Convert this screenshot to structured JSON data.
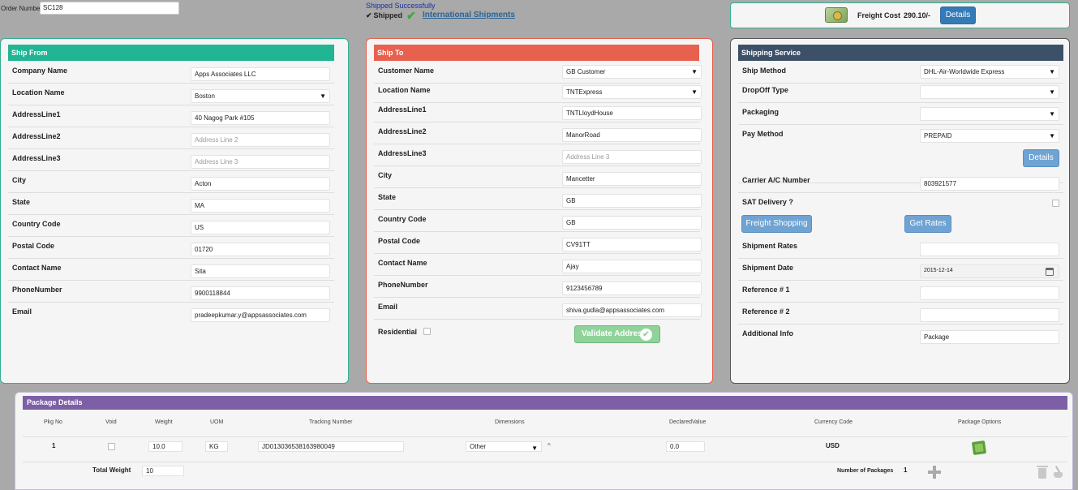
{
  "order": {
    "label": "Order Number",
    "value": "SC128"
  },
  "status": {
    "message": "Shipped Successfully",
    "checkmark": "✔",
    "state": "Shipped",
    "intl_link": "International Shipments"
  },
  "freight": {
    "label": "Freight Cost",
    "value": "290.10/-",
    "details_label": "Details"
  },
  "ship_from": {
    "title": "Ship From",
    "company_label": "Company Name",
    "company_value": "Apps Associates LLC",
    "location_label": "Location Name",
    "location_value": "Boston",
    "addr1_label": "AddressLine1",
    "addr1_value": "40 Nagog Park #105",
    "addr2_label": "AddressLine2",
    "addr2_placeholder": "Address Line 2",
    "addr3_label": "AddressLine3",
    "addr3_placeholder": "Address Line 3",
    "city_label": "City",
    "city_value": "Acton",
    "state_label": "State",
    "state_value": "MA",
    "country_label": "Country Code",
    "country_value": "US",
    "postal_label": "Postal Code",
    "postal_value": "01720",
    "contact_label": "Contact Name",
    "contact_value": "Sita",
    "phone_label": "PhoneNumber",
    "phone_value": "9900118844",
    "email_label": "Email",
    "email_value": "pradeepkumar.y@appsassociates.com"
  },
  "ship_to": {
    "title": "Ship To",
    "customer_label": "Customer Name",
    "customer_value": "GB Customer",
    "location_label": "Location Name",
    "location_value": "TNTExpress",
    "addr1_label": "AddressLine1",
    "addr1_value": "TNTLloydHouse",
    "addr2_label": "AddressLine2",
    "addr2_value": "ManorRoad",
    "addr3_label": "AddressLine3",
    "addr3_placeholder": "Address Line 3",
    "city_label": "City",
    "city_value": "Mancetter",
    "state_label": "State",
    "state_value": "GB",
    "country_label": "Country Code",
    "country_value": "GB",
    "postal_label": "Postal Code",
    "postal_value": "CV91TT",
    "contact_label": "Contact Name",
    "contact_value": "Ajay",
    "phone_label": "PhoneNumber",
    "phone_value": "9123456789",
    "email_label": "Email",
    "email_value": "shiva.gudla@appsassociates.com",
    "residential_label": "Residential",
    "validate_label": "Validate Address"
  },
  "service": {
    "title": "Shipping Service",
    "method_label": "Ship Method",
    "method_value": "DHL-Air-Worldwide Express",
    "dropoff_label": "DropOff Type",
    "dropoff_value": "",
    "packaging_label": "Packaging",
    "packaging_value": "",
    "pay_label": "Pay Method",
    "pay_value": "PREPAID",
    "details_label": "Details",
    "carrier_label": "Carrier A/C Number",
    "carrier_value": "803921577",
    "sat_label": "SAT Delivery ?",
    "freight_shop_label": "Freight Shopping",
    "get_rates_label": "Get Rates",
    "rates_label": "Shipment Rates",
    "rates_value": "",
    "date_label": "Shipment Date",
    "date_value": "2015-12-14",
    "ref1_label": "Reference # 1",
    "ref1_value": "",
    "ref2_label": "Reference # 2",
    "ref2_value": "",
    "info_label": "Additional Info",
    "info_value": "Package"
  },
  "package": {
    "title": "Package Details",
    "columns": [
      "Pkg No",
      "Void",
      "Weight",
      "UOM",
      "Tracking Number",
      "Dimensions",
      "DeclaredValue",
      "Currency Code",
      "Package Options"
    ],
    "rows": [
      {
        "pkg_no": "1",
        "weight": "10.0",
        "uom": "KG",
        "tracking": "JD013036538163980049",
        "dimensions": "Other",
        "dim_toggle": "^",
        "declared": "0.0",
        "currency": "USD"
      }
    ],
    "total_weight_label": "Total Weight",
    "total_weight_value": "10",
    "num_packages_label": "Number of Packages",
    "num_packages_value": "1"
  }
}
